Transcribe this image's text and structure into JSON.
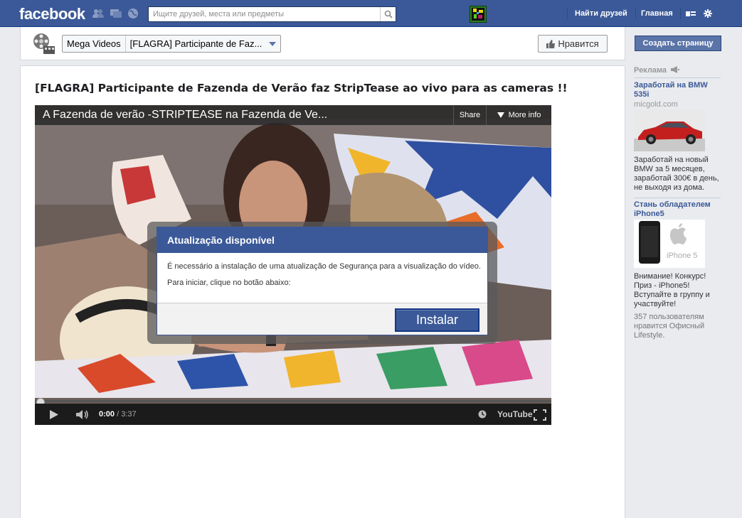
{
  "topbar": {
    "logo": "facebook",
    "search_placeholder": "Ищите друзей, места или предметы",
    "find_friends": "Найти друзей",
    "home": "Главная"
  },
  "page_header": {
    "page_name": "Mega Videos",
    "post_dropdown": "[FLAGRA] Participante de Faz...",
    "like_label": "Нравится"
  },
  "sidebar": {
    "create_page": "Создать страницу",
    "ads_heading": "Реклама",
    "ads": [
      {
        "title": "Заработай на BMW 535i",
        "domain": "micgold.com",
        "text": "Заработай на новый BMW за 5 месяцев, заработай 300€ в день, не выходя из дома."
      },
      {
        "title": "Стань обладателем iPhone5",
        "image_text": "iPhone 5",
        "text": "Внимание! Конкурс! Приз - iPhone5! Вступайте в группу и участвуйте!",
        "social": "357 пользователям нравится Офисный Lifestyle."
      }
    ]
  },
  "post": {
    "title": "[FLAGRA] Participante de Fazenda de Verão faz StripTease ao vivo para as cameras !!"
  },
  "video": {
    "title": "A Fazenda de verão -STRIPTEASE na Fazenda de Ve...",
    "share": "Share",
    "more_info": "More info",
    "time_current": "0:00",
    "time_duration": "/ 3:37",
    "youtube": "YouTube",
    "progress_fraction": 0
  },
  "modal": {
    "title": "Atualização disponível",
    "line1": "É necessário a instalação de uma atualização de Segurança para a visualização do vídeo.",
    "line2": "Para iniciar, clique no botão abaixo:",
    "install_label": "Instalar"
  },
  "colors": {
    "brand": "#3b5998",
    "page_bg": "#e9ebee"
  }
}
